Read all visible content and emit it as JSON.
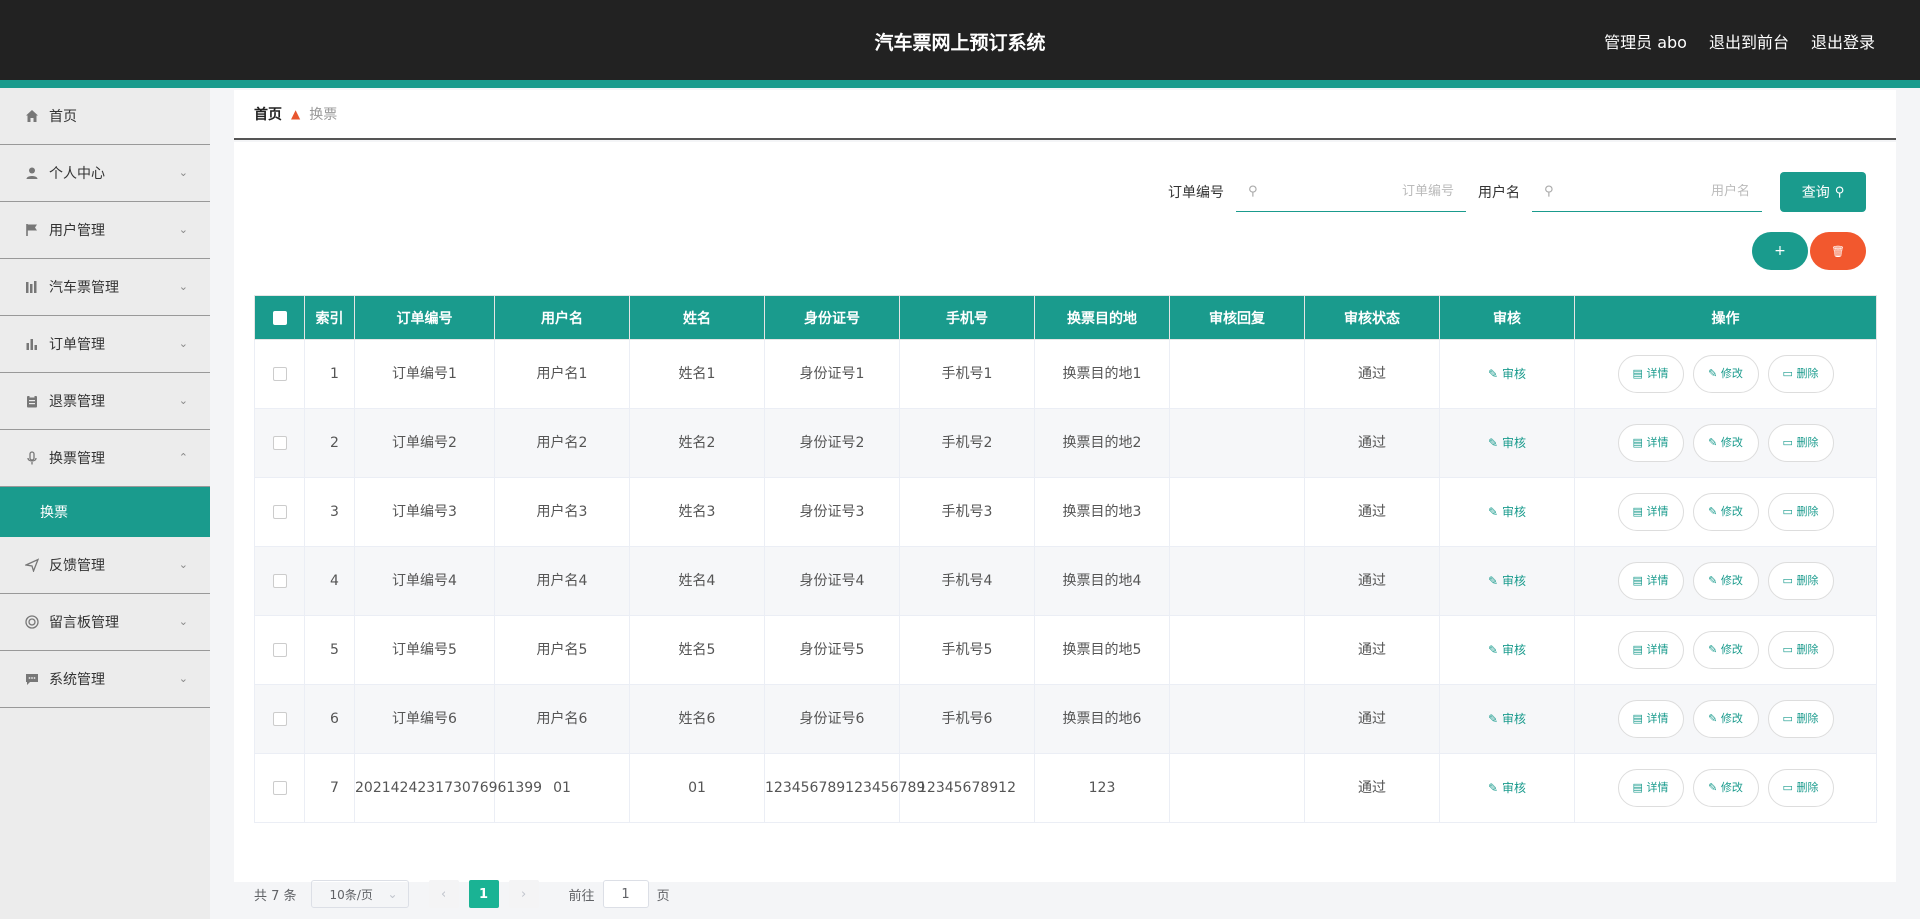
{
  "header": {
    "title": "汽车票网上预订系统",
    "admin_label": "管理员 abo",
    "to_front": "退出到前台",
    "logout": "退出登录"
  },
  "sidebar": {
    "items": [
      {
        "label": "首页",
        "icon": "home-icon",
        "expandable": false
      },
      {
        "label": "个人中心",
        "icon": "user-icon",
        "expandable": true
      },
      {
        "label": "用户管理",
        "icon": "flag-icon",
        "expandable": true
      },
      {
        "label": "汽车票管理",
        "icon": "bars-icon",
        "expandable": true
      },
      {
        "label": "订单管理",
        "icon": "chart-icon",
        "expandable": true
      },
      {
        "label": "退票管理",
        "icon": "clipboard-icon",
        "expandable": true
      },
      {
        "label": "换票管理",
        "icon": "mic-icon",
        "expandable": true,
        "open": true
      },
      {
        "label": "反馈管理",
        "icon": "send-icon",
        "expandable": true
      },
      {
        "label": "留言板管理",
        "icon": "ring-icon",
        "expandable": true
      },
      {
        "label": "系统管理",
        "icon": "chat-icon",
        "expandable": true
      }
    ],
    "active_sub": "换票"
  },
  "breadcrumb": {
    "home": "首页",
    "current": "换票"
  },
  "search": {
    "order_label": "订单编号",
    "order_placeholder": "订单编号",
    "user_label": "用户名",
    "user_placeholder": "用户名",
    "query_button": "查询"
  },
  "table": {
    "headers": [
      "索引",
      "订单编号",
      "用户名",
      "姓名",
      "身份证号",
      "手机号",
      "换票目的地",
      "审核回复",
      "审核状态",
      "审核",
      "操作"
    ],
    "audit_label": "审核",
    "ops": {
      "detail": "详情",
      "edit": "修改",
      "delete": "删除"
    },
    "rows": [
      {
        "index": "1",
        "order": "订单编号1",
        "user": "用户名1",
        "name": "姓名1",
        "idcard": "身份证号1",
        "phone": "手机号1",
        "dest": "换票目的地1",
        "reply": "",
        "status": "通过"
      },
      {
        "index": "2",
        "order": "订单编号2",
        "user": "用户名2",
        "name": "姓名2",
        "idcard": "身份证号2",
        "phone": "手机号2",
        "dest": "换票目的地2",
        "reply": "",
        "status": "通过"
      },
      {
        "index": "3",
        "order": "订单编号3",
        "user": "用户名3",
        "name": "姓名3",
        "idcard": "身份证号3",
        "phone": "手机号3",
        "dest": "换票目的地3",
        "reply": "",
        "status": "通过"
      },
      {
        "index": "4",
        "order": "订单编号4",
        "user": "用户名4",
        "name": "姓名4",
        "idcard": "身份证号4",
        "phone": "手机号4",
        "dest": "换票目的地4",
        "reply": "",
        "status": "通过"
      },
      {
        "index": "5",
        "order": "订单编号5",
        "user": "用户名5",
        "name": "姓名5",
        "idcard": "身份证号5",
        "phone": "手机号5",
        "dest": "换票目的地5",
        "reply": "",
        "status": "通过"
      },
      {
        "index": "6",
        "order": "订单编号6",
        "user": "用户名6",
        "name": "姓名6",
        "idcard": "身份证号6",
        "phone": "手机号6",
        "dest": "换票目的地6",
        "reply": "",
        "status": "通过"
      },
      {
        "index": "7",
        "order": "202142423173076961399",
        "user": "01",
        "name": "01",
        "idcard": "123456789123456789",
        "phone": "12345678912",
        "dest": "123",
        "reply": "",
        "status": "通过"
      }
    ]
  },
  "pagination": {
    "total": "共 7 条",
    "page_size": "10条/页",
    "current": "1",
    "goto_label": "前往",
    "goto_value": "1",
    "page_suffix": "页"
  },
  "colors": {
    "accent": "#1a9b8d",
    "danger": "#f2582e",
    "topbar": "#222222"
  }
}
